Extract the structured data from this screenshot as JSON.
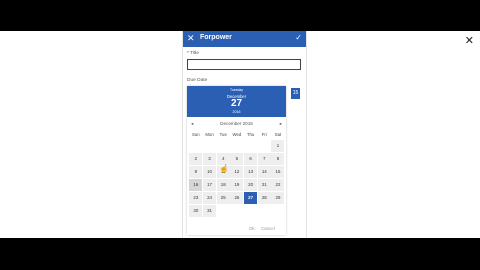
{
  "app": {
    "title": "Forpower",
    "close_icon": "close-icon",
    "confirm_icon": "checkmark-icon"
  },
  "form": {
    "title_label": "Title",
    "required_mark": "*",
    "title_value": "",
    "due_date_label": "Due Date"
  },
  "calendar": {
    "weekday": "Tuesday",
    "month": "December",
    "day": "27",
    "year": "2016",
    "nav_label": "December 2016",
    "prev_icon": "chevron-left-icon",
    "next_icon": "chevron-right-icon",
    "dow": [
      "Sun",
      "Mon",
      "Tue",
      "Wed",
      "Thu",
      "Fri",
      "Sat"
    ],
    "weeks": [
      [
        "",
        "",
        "",
        "",
        "",
        "",
        "1"
      ],
      [
        "2",
        "3",
        "4",
        "5",
        "6",
        "7",
        "8"
      ],
      [
        "9",
        "10",
        "11",
        "12",
        "13",
        "14",
        "15"
      ],
      [
        "16",
        "17",
        "18",
        "19",
        "20",
        "21",
        "22"
      ],
      [
        "23",
        "24",
        "25",
        "26",
        "27",
        "28",
        "29"
      ],
      [
        "30",
        "31",
        "",
        "",
        "",
        "",
        ""
      ]
    ],
    "selected": "27",
    "ok_label": "Ok",
    "cancel_label": "Cancel"
  },
  "side_button": {
    "label": "15",
    "icon": "calendar-icon"
  },
  "accent_color": "#2b5fb3"
}
